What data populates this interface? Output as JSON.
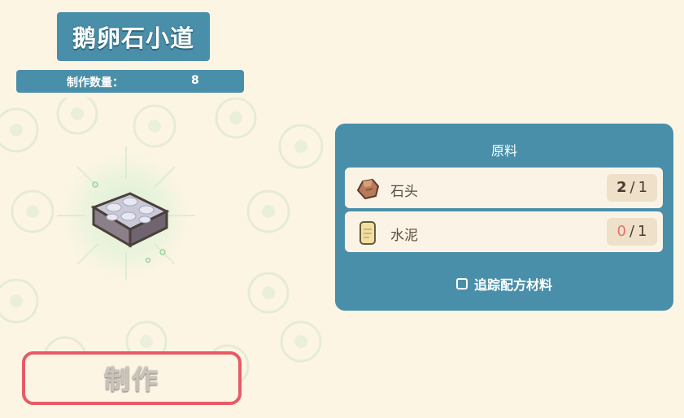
{
  "item": {
    "name": "鹅卵石小道",
    "count_label": "制作数量：",
    "count_value": "8"
  },
  "craft_button_label": "制作",
  "materials_panel": {
    "title": "原料",
    "materials": [
      {
        "name": "石头",
        "have": "2",
        "need": "1",
        "icon": "stone-icon"
      },
      {
        "name": "水泥",
        "have": "0",
        "need": "1",
        "icon": "cement-bag-icon"
      }
    ],
    "track_label": "追踪配方材料",
    "track_checked": false
  },
  "colors": {
    "panel": "#4a8fa9",
    "background": "#fdf5e4",
    "button_border": "#e85a64",
    "insufficient": "#e8706a"
  }
}
